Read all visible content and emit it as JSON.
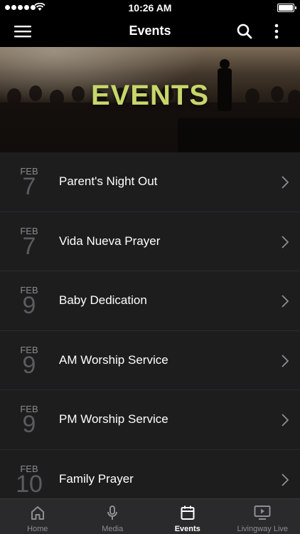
{
  "status_bar": {
    "time": "10:26 AM"
  },
  "nav": {
    "title": "Events",
    "menu_icon": "hamburger-menu-icon",
    "search_icon": "search-icon",
    "more_icon": "more-vertical-icon"
  },
  "hero": {
    "title": "EVENTS",
    "title_color": "#c7d66a"
  },
  "events": [
    {
      "month": "FEB",
      "day": "7",
      "name": "Parent's Night Out"
    },
    {
      "month": "FEB",
      "day": "7",
      "name": "Vida Nueva Prayer"
    },
    {
      "month": "FEB",
      "day": "9",
      "name": "Baby Dedication"
    },
    {
      "month": "FEB",
      "day": "9",
      "name": "AM Worship Service"
    },
    {
      "month": "FEB",
      "day": "9",
      "name": "PM Worship Service"
    },
    {
      "month": "FEB",
      "day": "10",
      "name": "Family Prayer"
    }
  ],
  "tabs": [
    {
      "label": "Home",
      "icon": "home-icon",
      "active": false
    },
    {
      "label": "Media",
      "icon": "microphone-icon",
      "active": false
    },
    {
      "label": "Events",
      "icon": "calendar-icon",
      "active": true
    },
    {
      "label": "Livingway Live",
      "icon": "tv-play-icon",
      "active": false
    }
  ]
}
